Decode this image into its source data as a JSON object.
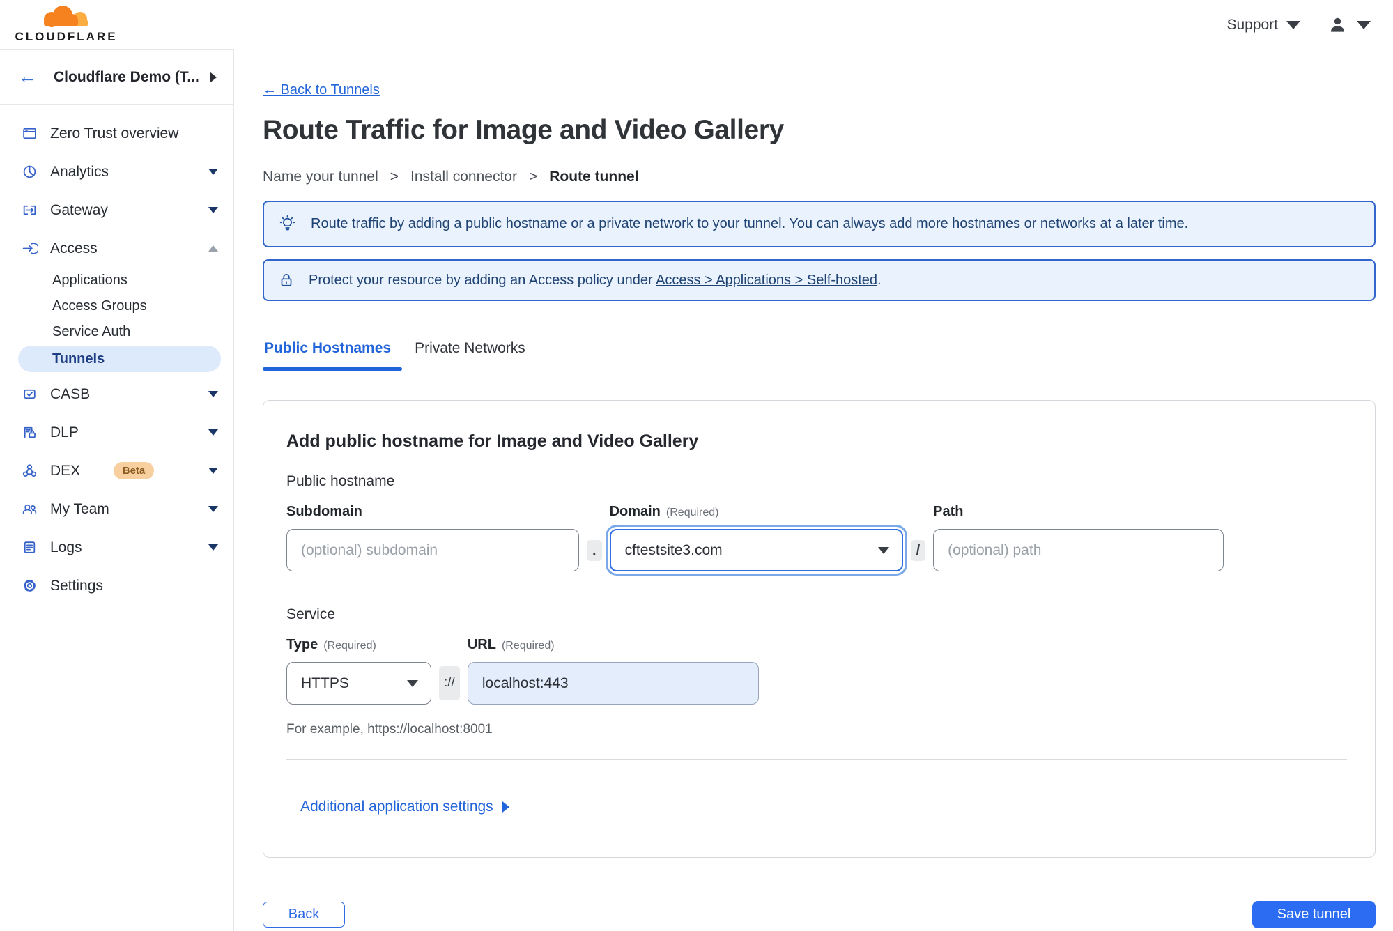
{
  "colors": {
    "accent_blue": "#2264d9",
    "save_button_blue": "#2c6cf2",
    "banner_border": "#3366cc",
    "banner_bg": "#e9f2fd",
    "banner_text": "#1e4272",
    "sidebar_icon_blue": "#3662c9",
    "active_item_bg": "#ddeafc",
    "logo_orange": "#f6821f",
    "logo_light_orange": "#fbad41"
  },
  "header": {
    "brand": "CLOUDFLARE",
    "support_label": "Support"
  },
  "sidebar": {
    "account_name": "Cloudflare Demo (T...",
    "back_glyph": "←",
    "items": [
      {
        "label": "Zero Trust overview"
      },
      {
        "label": "Analytics"
      },
      {
        "label": "Gateway"
      },
      {
        "label": "Access"
      },
      {
        "label": "CASB"
      },
      {
        "label": "DLP"
      },
      {
        "label": "DEX",
        "badge": "Beta"
      },
      {
        "label": "My Team"
      },
      {
        "label": "Logs"
      },
      {
        "label": "Settings"
      }
    ],
    "access_children": [
      {
        "label": "Applications"
      },
      {
        "label": "Access Groups"
      },
      {
        "label": "Service Auth"
      },
      {
        "label": "Tunnels"
      }
    ]
  },
  "page": {
    "back_link": "← Back to Tunnels",
    "title": "Route Traffic for Image and Video Gallery",
    "steps": {
      "step1": "Name your tunnel",
      "step2": "Install connector",
      "step3": "Route tunnel"
    },
    "step_separator": ">",
    "banner_route": "Route traffic by adding a public hostname or a private network to your tunnel. You can always add more hostnames or networks at a later time.",
    "banner_protect_before": "Protect your resource by adding an Access policy under ",
    "banner_protect_link": "Access > Applications > Self-hosted",
    "banner_protect_after": ".",
    "tabs": {
      "public": "Public Hostnames",
      "private": "Private Networks"
    }
  },
  "form": {
    "heading": "Add public hostname for Image and Video Gallery",
    "public_hostname_label": "Public hostname",
    "subdomain_label": "Subdomain",
    "subdomain_placeholder": "(optional) subdomain",
    "dot_separator": ".",
    "domain_label": "Domain",
    "domain_required": "(Required)",
    "domain_value": "cftestsite3.com",
    "slash_separator": "/",
    "path_label": "Path",
    "path_placeholder": "(optional) path",
    "service_label": "Service",
    "type_label": "Type",
    "type_required": "(Required)",
    "type_value": "HTTPS",
    "scheme_separator": "://",
    "url_label": "URL",
    "url_required": "(Required)",
    "url_value": "localhost:443",
    "url_example": "For example, https://localhost:8001",
    "additional_settings_label": "Additional application settings"
  },
  "footer": {
    "back_label": "Back",
    "save_label": "Save tunnel"
  }
}
